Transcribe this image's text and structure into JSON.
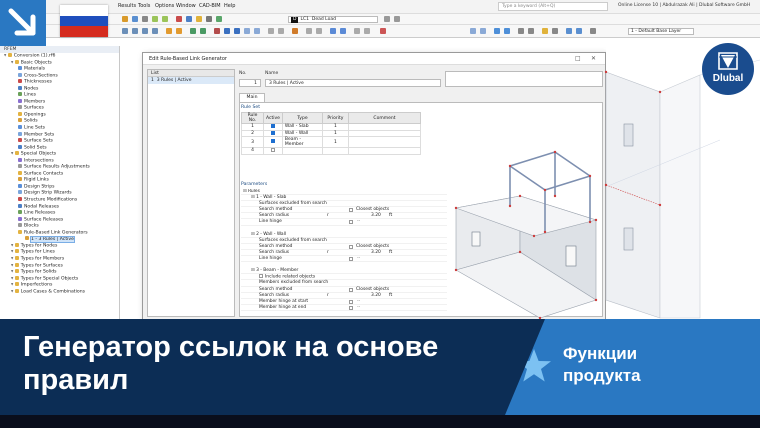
{
  "app": {
    "menus": [
      "Results",
      "Tools",
      "Options",
      "Window",
      "CAD-BIM",
      "Help"
    ],
    "search_placeholder": "Type a keyword (Alt+Q)",
    "license_info": "Online License 10 | Abdulrazak Ali | Dlubal Software GmbH",
    "load_case_chip": "D",
    "load_case_id": "LC1",
    "load_case_name": "Dead Load",
    "visibility_combo": "1 - Default Base Layer"
  },
  "navigator": {
    "title": "RFEM",
    "items": [
      {
        "label": "Conversion (1).rf6",
        "level": 0
      },
      {
        "label": "Basic Objects",
        "level": 1
      },
      {
        "label": "Materials",
        "level": 2
      },
      {
        "label": "Cross-Sections",
        "level": 2
      },
      {
        "label": "Thicknesses",
        "level": 2
      },
      {
        "label": "Nodes",
        "level": 2
      },
      {
        "label": "Lines",
        "level": 2
      },
      {
        "label": "Members",
        "level": 2
      },
      {
        "label": "Surfaces",
        "level": 2
      },
      {
        "label": "Openings",
        "level": 2
      },
      {
        "label": "Solids",
        "level": 2
      },
      {
        "label": "Line Sets",
        "level": 2
      },
      {
        "label": "Member Sets",
        "level": 2
      },
      {
        "label": "Surface Sets",
        "level": 2
      },
      {
        "label": "Solid Sets",
        "level": 2
      },
      {
        "label": "Special Objects",
        "level": 1
      },
      {
        "label": "Intersections",
        "level": 2
      },
      {
        "label": "Surface Results Adjustments",
        "level": 2
      },
      {
        "label": "Surface Contacts",
        "level": 2
      },
      {
        "label": "Rigid Links",
        "level": 2
      },
      {
        "label": "Design Strips",
        "level": 2
      },
      {
        "label": "Design Strip Wizards",
        "level": 2
      },
      {
        "label": "Structure Modifications",
        "level": 2
      },
      {
        "label": "Nodal Releases",
        "level": 2
      },
      {
        "label": "Line Releases",
        "level": 2
      },
      {
        "label": "Surface Releases",
        "level": 2
      },
      {
        "label": "Blocks",
        "level": 2
      },
      {
        "label": "Rule-Based Link Generators",
        "level": 2
      },
      {
        "label": "1 - 3 Rules | Active",
        "level": 3,
        "selected": true
      },
      {
        "label": "Types for Nodes",
        "level": 1
      },
      {
        "label": "Types for Lines",
        "level": 1
      },
      {
        "label": "Types for Members",
        "level": 1
      },
      {
        "label": "Types for Surfaces",
        "level": 1
      },
      {
        "label": "Types for Solids",
        "level": 1
      },
      {
        "label": "Types for Special Objects",
        "level": 1
      },
      {
        "label": "Imperfections",
        "level": 1
      },
      {
        "label": "Load Cases & Combinations",
        "level": 1
      }
    ]
  },
  "dialog": {
    "title": "Edit Rule-Based Link Generator",
    "list_header": "List",
    "list_item_no": "1",
    "list_item_label": "3 Rules | Active",
    "no_label": "No.",
    "no_value": "1",
    "name_label": "Name",
    "name_value": "3 Rules | Active",
    "tab_main": "Main",
    "rule_set_label": "Rule Set",
    "rule_columns": [
      "Rule No.",
      "Active",
      "Type",
      "Priority",
      "Comment"
    ],
    "rules": [
      {
        "no": "1",
        "active": true,
        "type": "Wall - Slab",
        "priority": "1",
        "comment": ""
      },
      {
        "no": "2",
        "active": true,
        "type": "Wall - Wall",
        "priority": "1",
        "comment": ""
      },
      {
        "no": "3",
        "active": true,
        "type": "Beam - Member",
        "priority": "1",
        "comment": ""
      },
      {
        "no": "4",
        "active": false,
        "type": "",
        "priority": "",
        "comment": ""
      }
    ],
    "parameters_label": "Parameters",
    "params": [
      {
        "kind": "grp",
        "label": "Rules"
      },
      {
        "kind": "grp",
        "label": "1 - Wall - Slab",
        "indent": 1
      },
      {
        "kind": "item",
        "label": "Surfaces excluded from search",
        "indent": 2
      },
      {
        "kind": "item",
        "label": "Search method",
        "indent": 2,
        "value": "Closest objects"
      },
      {
        "kind": "item",
        "label": "Search radius",
        "indent": 2,
        "sym": "r",
        "value": "3.20",
        "unit": "ft"
      },
      {
        "kind": "item",
        "label": "Line hinge",
        "indent": 2,
        "extra": "--"
      },
      {
        "kind": "gap"
      },
      {
        "kind": "grp",
        "label": "2 - Wall - Wall",
        "indent": 1
      },
      {
        "kind": "item",
        "label": "Surfaces excluded from search",
        "indent": 2
      },
      {
        "kind": "item",
        "label": "Search method",
        "indent": 2,
        "value": "Closest objects"
      },
      {
        "kind": "item",
        "label": "Search radius",
        "indent": 2,
        "sym": "r",
        "value": "3.20",
        "unit": "ft"
      },
      {
        "kind": "item",
        "label": "Line hinge",
        "indent": 2,
        "extra": "--"
      },
      {
        "kind": "gap"
      },
      {
        "kind": "grp",
        "label": "3 - Beam - Member",
        "indent": 1
      },
      {
        "kind": "item",
        "label": "Include related objects",
        "indent": 2,
        "check": true
      },
      {
        "kind": "item",
        "label": "Members excluded from search",
        "indent": 2
      },
      {
        "kind": "item",
        "label": "Search method",
        "indent": 2,
        "value": "Closest objects"
      },
      {
        "kind": "item",
        "label": "Search radius",
        "indent": 2,
        "sym": "r",
        "value": "3.20",
        "unit": "ft"
      },
      {
        "kind": "item",
        "label": "Member hinge at start",
        "indent": 2,
        "extra": "--"
      },
      {
        "kind": "item",
        "label": "Member hinge at end",
        "indent": 2,
        "extra": "--"
      }
    ]
  },
  "banner": {
    "title": "Генератор ссылок на основе правил",
    "feature": "Функции продукта"
  },
  "logo": {
    "text": "Dlubal"
  },
  "colors": {
    "banner_bg": "#0c2d55",
    "accent_blue": "#2a78c2",
    "logo_blue": "#1a4c8e"
  }
}
